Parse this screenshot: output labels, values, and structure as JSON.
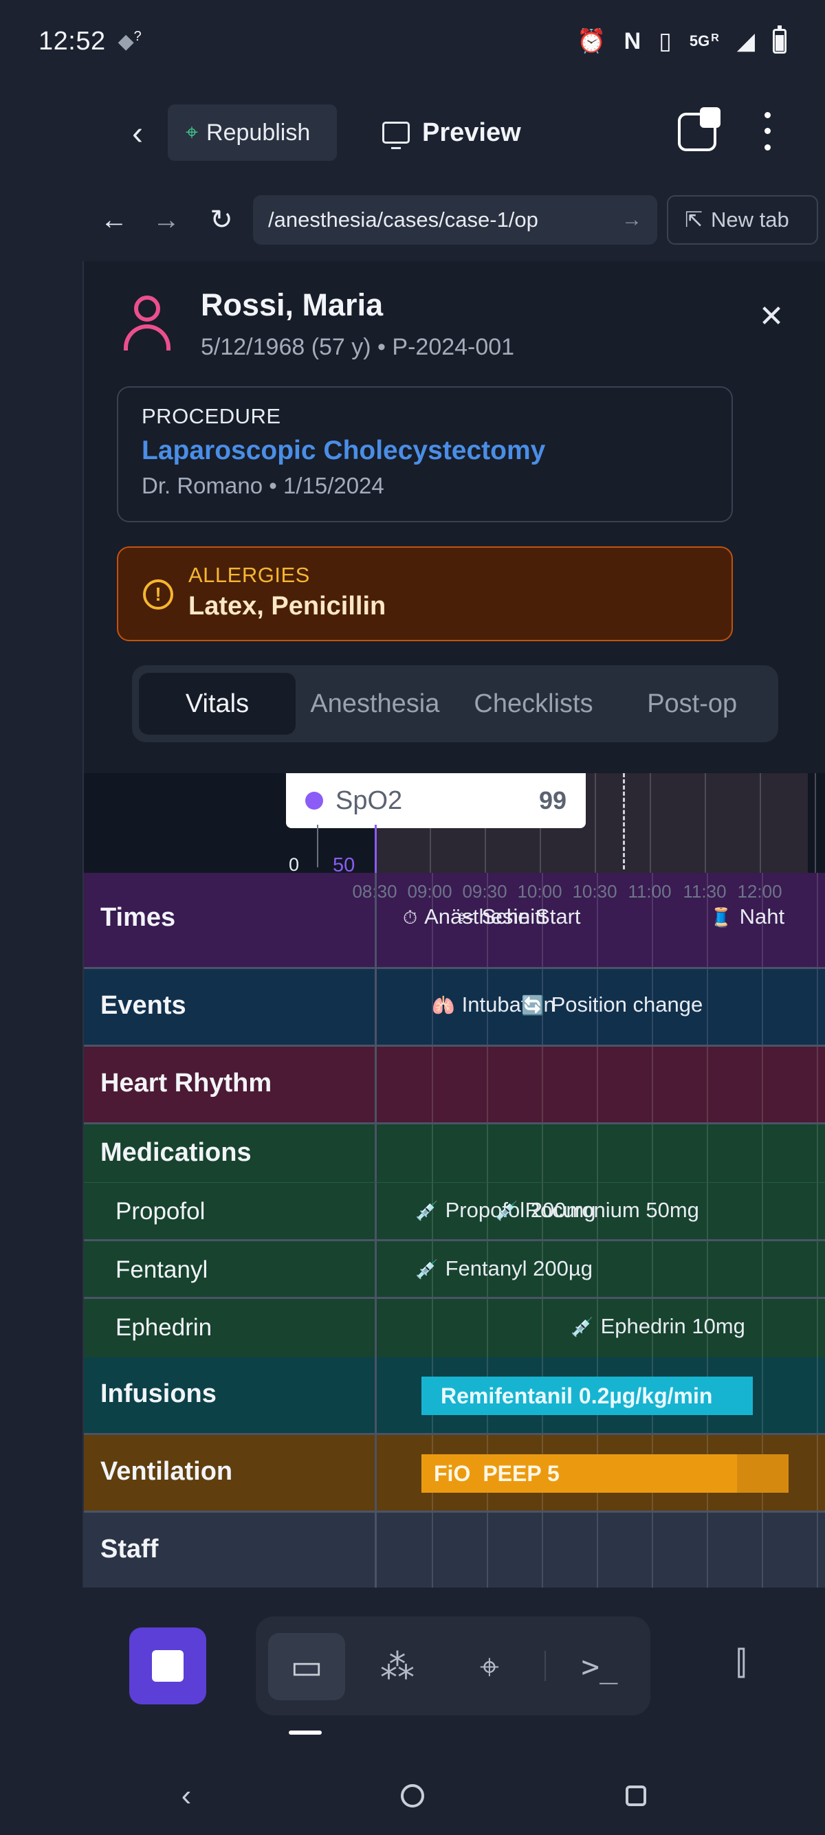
{
  "status_bar": {
    "time": "12:52",
    "wifi_badge": "?",
    "network": "5G",
    "network_sub": "R",
    "icons": [
      "wifi-icon",
      "alarm-icon",
      "nfc-icon",
      "vibrate-icon",
      "signal-icon",
      "battery-icon"
    ]
  },
  "app_toolbar": {
    "republish_label": "Republish",
    "preview_label": "Preview"
  },
  "browser": {
    "url": "/anesthesia/cases/case-1/op",
    "new_tab_label": "New tab"
  },
  "patient": {
    "name": "Rossi, Maria",
    "meta": "5/12/1968 (57 y) • P-2024-001",
    "procedure_label": "PROCEDURE",
    "procedure_name": "Laparoscopic Cholecystectomy",
    "procedure_details": "Dr. Romano • 1/15/2024",
    "allergies_label": "ALLERGIES",
    "allergies_value": "Latex, Penicillin"
  },
  "tabs": [
    {
      "label": "Vitals",
      "active": true
    },
    {
      "label": "Anesthesia",
      "active": false
    },
    {
      "label": "Checklists",
      "active": false
    },
    {
      "label": "Post-op",
      "active": false
    }
  ],
  "vitals_chart": {
    "tooltip_series": "SpO2",
    "tooltip_value": "99",
    "tooltip_color": "#8b5cf6",
    "axis_zero": "0",
    "axis_fifty": "50",
    "time_ticks": [
      "08:30",
      "09:00",
      "09:30",
      "10:00",
      "10:30",
      "11:00",
      "11:30",
      "12:00"
    ]
  },
  "timeline": {
    "times": {
      "label": "Times",
      "events": [
        {
          "icon": "⏱",
          "text": "Anästhesie Start"
        },
        {
          "icon": "✂",
          "text": "Schnitt"
        },
        {
          "icon": "🧵",
          "text": "Naht"
        }
      ]
    },
    "events": {
      "label": "Events",
      "items": [
        {
          "icon": "🫁",
          "text": "Intubation"
        },
        {
          "icon": "🔄",
          "text": "Position change"
        }
      ]
    },
    "heart_rhythm": {
      "label": "Heart Rhythm"
    },
    "medications": {
      "label": "Medications",
      "drugs": [
        {
          "name": "Propofol",
          "doses": [
            {
              "icon": "💉",
              "text": "Propofol 200mg"
            },
            {
              "icon": "💉",
              "text": "Rocuronium 50mg"
            }
          ]
        },
        {
          "name": "Fentanyl",
          "doses": [
            {
              "icon": "💉",
              "text": "Fentanyl 200µg"
            }
          ]
        },
        {
          "name": "Ephedrin",
          "doses": [
            {
              "icon": "💉",
              "text": "Ephedrin 10mg"
            }
          ]
        }
      ]
    },
    "infusions": {
      "label": "Infusions",
      "bar_text": "Remifentanil 0.2µg/kg/min",
      "bar_color": "#17b4d1"
    },
    "ventilation": {
      "label": "Ventilation",
      "bar_text_a": "FiO",
      "bar_text_b": "PEEP 5",
      "bar_color": "#eb9a10"
    },
    "staff": {
      "label": "Staff"
    }
  },
  "dock": {
    "icons": [
      "stop-icon",
      "desktop-icon",
      "apps-icon",
      "broadcast-icon",
      "terminal-icon",
      "side-panel-icon"
    ]
  }
}
